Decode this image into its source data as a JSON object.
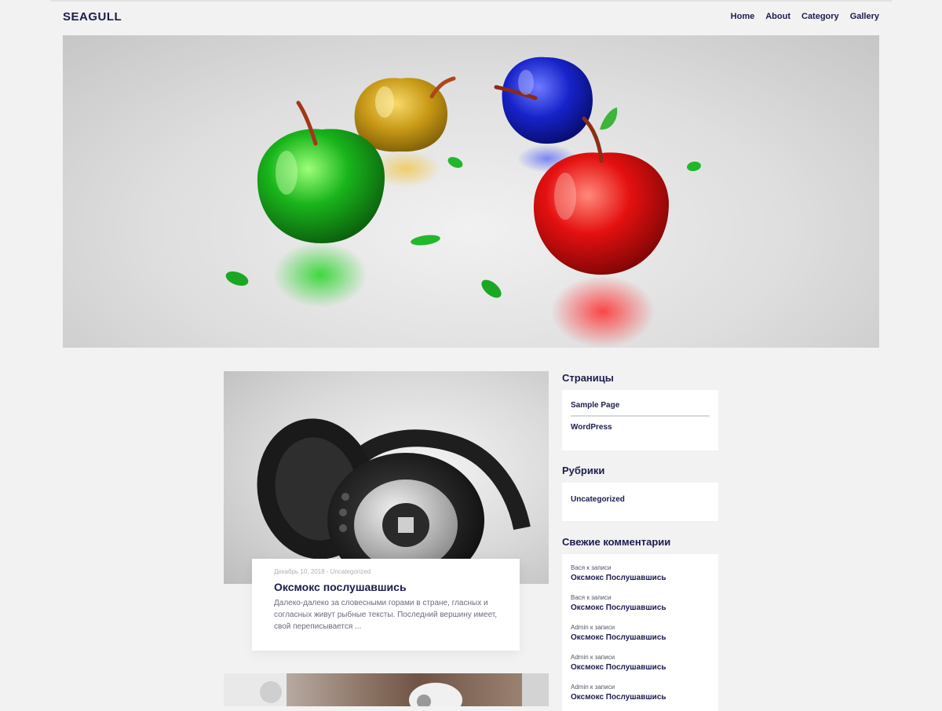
{
  "site": {
    "logo": "SEAGULL",
    "nav": [
      "Home",
      "About",
      "Category",
      "Gallery"
    ]
  },
  "post": {
    "meta": "Декабрь 10, 2018 - Uncategorized",
    "title": "Оксмокс послушавшись",
    "excerpt": "Далеко-далеко за словесными горами в стране, гласных и согласных живут рыбные тексты. Последний вершину имеет, свой переписывается ..."
  },
  "sidebar": {
    "pages": {
      "title": "Страницы",
      "items": [
        "Sample Page",
        "WordPress"
      ]
    },
    "categories": {
      "title": "Рубрики",
      "items": [
        "Uncategorized"
      ]
    },
    "comments": {
      "title": "Свежие комментарии",
      "items": [
        {
          "author": "Вася",
          "connector": "к записи",
          "post": "Оксмокс Послушавшись"
        },
        {
          "author": "Вася",
          "connector": "к записи",
          "post": "Оксмокс Послушавшись"
        },
        {
          "author": "Admin",
          "connector": "к записи",
          "post": "Оксмокс Послушавшись"
        },
        {
          "author": "Admin",
          "connector": "к записи",
          "post": "Оксмокс Послушавшись"
        },
        {
          "author": "Admin",
          "connector": "к записи",
          "post": "Оксмокс Послушавшись"
        }
      ]
    }
  },
  "colors": {
    "background": "#f2f2f2",
    "text_primary": "#1c1c4e",
    "card": "#ffffff"
  },
  "images": {
    "hero": "glass-apples-image",
    "post": "headphones-image"
  }
}
